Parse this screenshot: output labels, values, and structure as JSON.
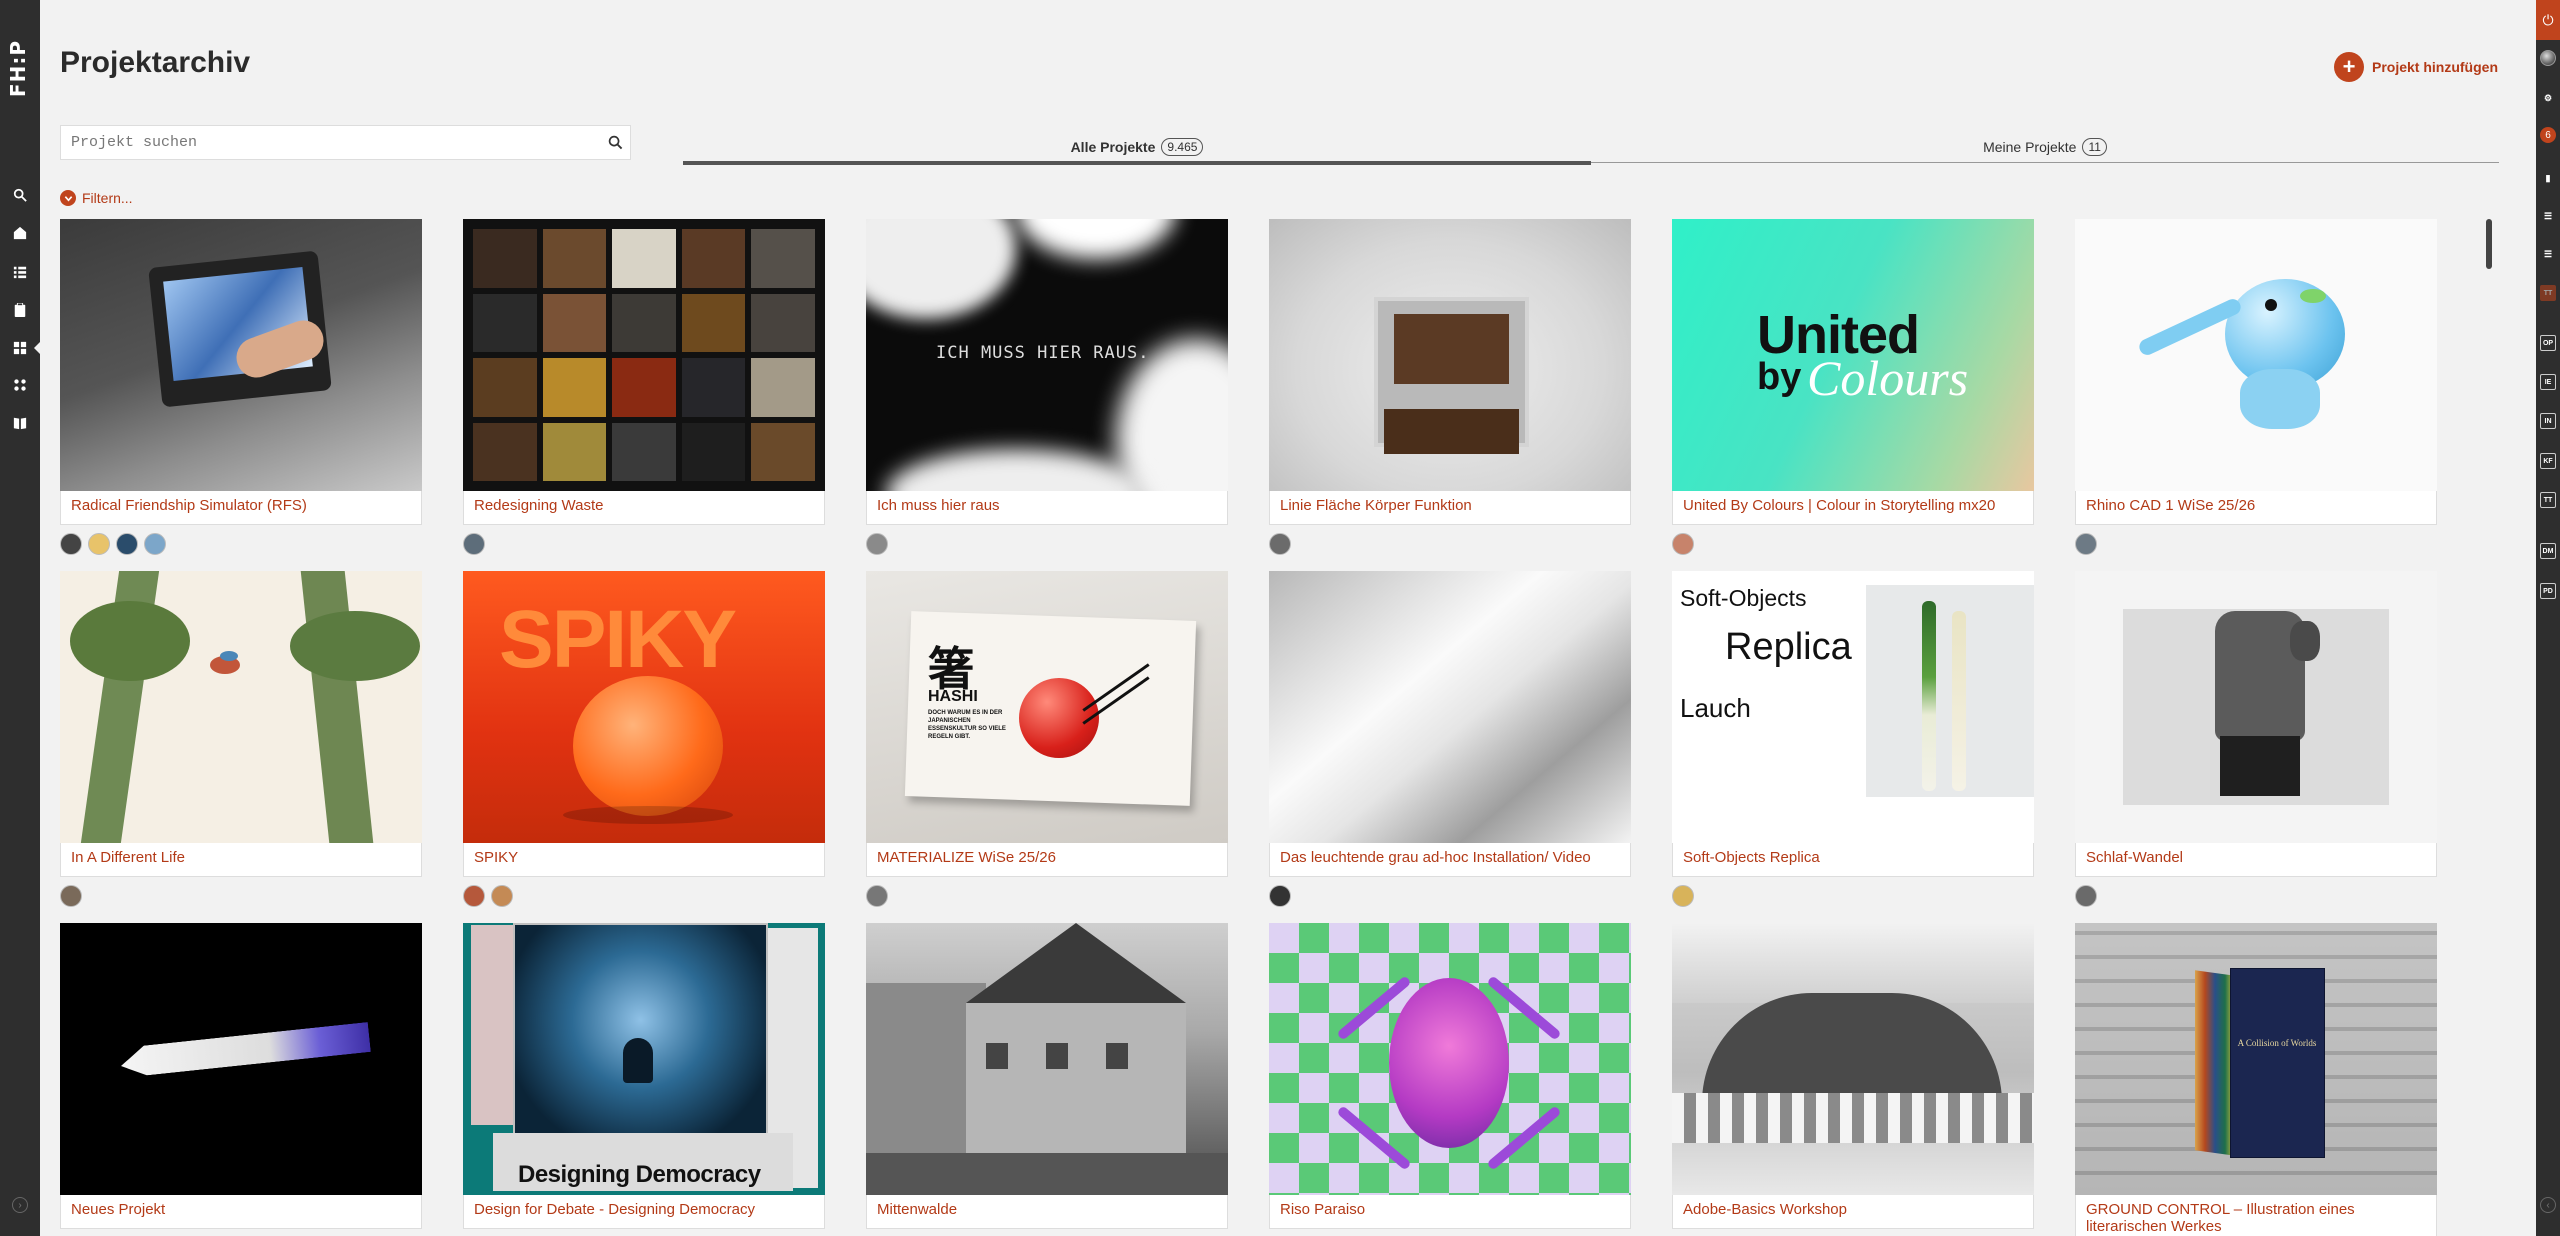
{
  "app": {
    "logo_text": "FH:P",
    "page_title": "Projektarchiv",
    "add_project_label": "Projekt hinzufügen"
  },
  "search": {
    "placeholder": "Projekt suchen",
    "value": ""
  },
  "tabs": [
    {
      "label": "Alle Projekte",
      "count": "9.465",
      "active": true
    },
    {
      "label": "Meine Projekte",
      "count": "11",
      "active": false
    }
  ],
  "filter_label": "Filtern...",
  "left_nav": {
    "icons": [
      "search-icon",
      "home-icon",
      "list-icon",
      "clipboard-icon",
      "grid-icon",
      "apps-icon",
      "book-icon"
    ]
  },
  "right_nav": {
    "notification_count": "6",
    "badges": [
      "TT",
      "OP",
      "IE",
      "IN",
      "KF",
      "TT",
      "DM",
      "PD"
    ]
  },
  "projects": [
    {
      "title": "Radical Friendship Simulator (RFS)",
      "avatars": [
        "#444",
        "#e8c36a",
        "#2a4c6b",
        "#7ca6c9"
      ]
    },
    {
      "title": "Redesigning Waste",
      "avatars": [
        "#5d6d7a"
      ]
    },
    {
      "title": "Ich muss hier raus",
      "avatars": [
        "#8a8a8a"
      ]
    },
    {
      "title": "Linie Fläche Körper Funktion",
      "avatars": [
        "#6b6b6b"
      ]
    },
    {
      "title": "United By Colours | Colour in Storytelling mx20",
      "avatars": [
        "#c7836b"
      ]
    },
    {
      "title": "Rhino CAD 1 WiSe 25/26",
      "avatars": [
        "#6d7a85"
      ]
    },
    {
      "title": "In A Different Life",
      "avatars": [
        "#7a6a5a"
      ]
    },
    {
      "title": "SPIKY",
      "avatars": [
        "#b5583b",
        "#c48a55"
      ]
    },
    {
      "title": "MATERIALIZE WiSe 25/26",
      "avatars": [
        "#777"
      ]
    },
    {
      "title": "Das leuchtende grau ad-hoc Installation/ Video",
      "avatars": [
        "#333"
      ]
    },
    {
      "title": "Soft-Objects Replica",
      "avatars": [
        "#d8b35a"
      ]
    },
    {
      "title": "Schlaf-Wandel",
      "avatars": [
        "#6a6a6a"
      ]
    },
    {
      "title": "Neues Projekt",
      "avatars": []
    },
    {
      "title": "Design for Debate - Designing Democracy",
      "avatars": []
    },
    {
      "title": "Mittenwalde",
      "avatars": []
    },
    {
      "title": "Riso Paraiso",
      "avatars": []
    },
    {
      "title": "Adobe-Basics Workshop",
      "avatars": []
    },
    {
      "title": "GROUND CONTROL – Illustration eines literarischen Werkes",
      "avatars": []
    }
  ],
  "thumbnail_text": {
    "ich_muss": "ICH MUSS HIER RAUS.",
    "united_1": "United",
    "united_2": "by",
    "united_3": "Colours",
    "spiky": "SPIKY",
    "hashi_glyph": "箸",
    "hashi": "HASHI",
    "hashi_body": "DOCH WARUM ES IN DER JAPANISCHEN ESSENSKULTUR SO VIELE REGELN GIBT.",
    "soft_objects": "Soft-Objects",
    "replica": "Replica",
    "lauch": "Lauch",
    "designing_democracy": "Designing Democracy",
    "ground_control": "A Collision of Worlds"
  },
  "colors": {
    "accent": "#c0441d",
    "link": "#b33a17",
    "rail": "#2e2e2e",
    "background": "#f2f2f2"
  }
}
